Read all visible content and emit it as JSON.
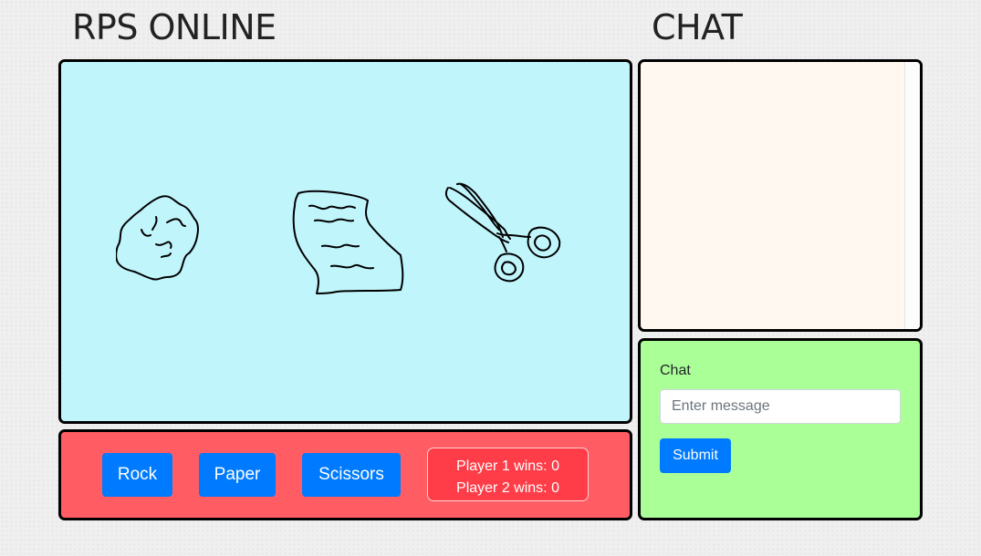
{
  "header": {
    "game_title": "RPS ONLINE",
    "chat_title": "CHAT"
  },
  "game": {
    "choices": [
      {
        "name": "rock",
        "icon": "rock-drawing-icon"
      },
      {
        "name": "paper",
        "icon": "paper-drawing-icon"
      },
      {
        "name": "scissors",
        "icon": "scissors-drawing-icon"
      }
    ]
  },
  "controls": {
    "rock_label": "Rock",
    "paper_label": "Paper",
    "scissors_label": "Scissors",
    "player1_wins": "Player 1 wins: 0",
    "player2_wins": "Player 2 wins: 0"
  },
  "chat": {
    "messages": [],
    "label": "Chat",
    "placeholder": "Enter message",
    "submit_label": "Submit"
  },
  "colors": {
    "game_area_bg": "#c1f5fc",
    "controls_bg": "#ff5c63",
    "chat_log_bg": "#fff8f0",
    "chat_form_bg": "#abff97",
    "button_primary": "#007bff",
    "scoreboard_bg": "#ff3d48"
  }
}
